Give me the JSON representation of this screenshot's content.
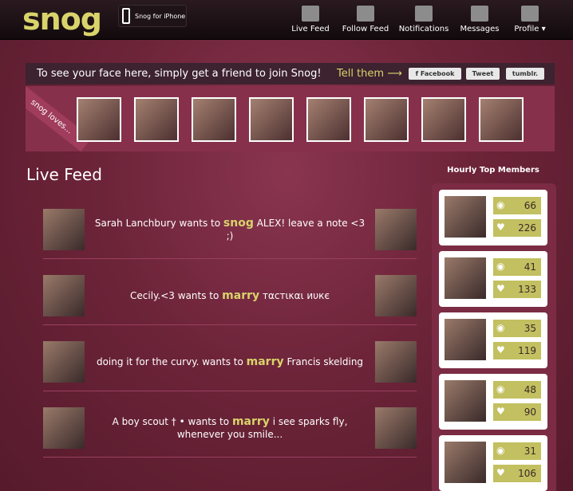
{
  "header": {
    "logo": "snog",
    "iphone_label": "Snog for iPhone",
    "nav": [
      {
        "label": "Live Feed",
        "icon": "film-icon"
      },
      {
        "label": "Follow Feed",
        "icon": "people-icon"
      },
      {
        "label": "Notifications",
        "icon": "alert-icon"
      },
      {
        "label": "Messages",
        "icon": "envelope-icon"
      },
      {
        "label": "Profile ▾",
        "icon": "avatar-icon"
      }
    ]
  },
  "invite": {
    "message": "To see your face here, simply get a friend to join Snog!",
    "tell": "Tell them ⟶",
    "facebook": "f  Facebook",
    "tweet": "Tweet",
    "tumblr": "tumblr."
  },
  "loves": {
    "ribbon": "snog loves..."
  },
  "feed": {
    "title": "Live Feed",
    "items": [
      {
        "left": "Sarah Lanchbury wants to",
        "verb": "snog",
        "right": "ALEX! leave a note <3 ;)"
      },
      {
        "left": "Cecily.<3 wants to",
        "verb": "marry",
        "right": "тαcтικαι иυкє"
      },
      {
        "left": "doing it for the curvy. wants to",
        "verb": "marry",
        "right": "Francis skelding"
      },
      {
        "left": "A boy scout † • wants to",
        "verb": "marry",
        "right": "i see sparks fly,",
        "line2": "whenever you smile..."
      }
    ]
  },
  "hourly": {
    "title": "Hourly Top Members",
    "members": [
      {
        "snogs": "66",
        "likes": "226"
      },
      {
        "snogs": "41",
        "likes": "133"
      },
      {
        "snogs": "35",
        "likes": "119"
      },
      {
        "snogs": "48",
        "likes": "90"
      },
      {
        "snogs": "31",
        "likes": "106"
      }
    ]
  }
}
